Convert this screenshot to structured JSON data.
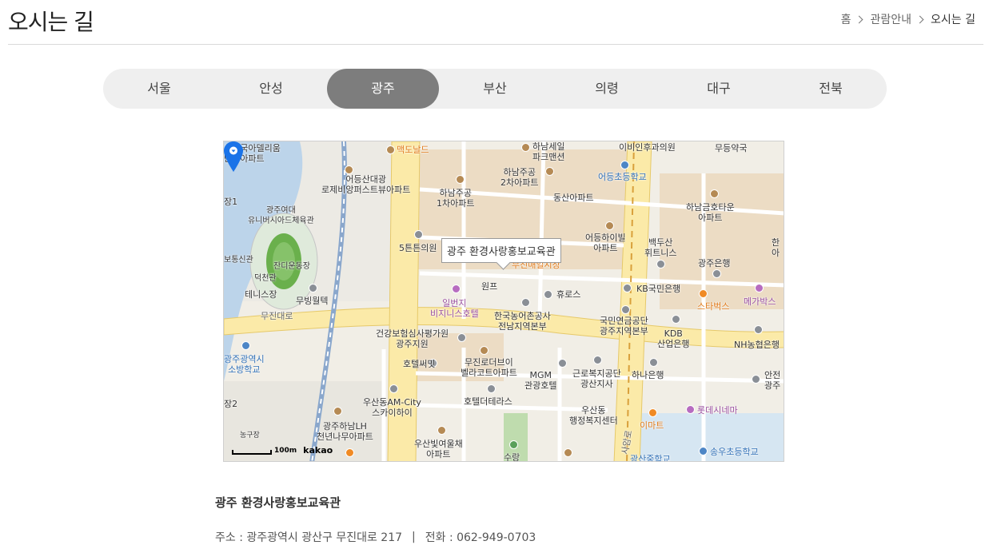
{
  "header": {
    "title": "오시는 길",
    "breadcrumb": [
      "홈",
      "관람안내",
      "오시는 길"
    ]
  },
  "tabs": [
    {
      "label": "서울",
      "active": false
    },
    {
      "label": "안성",
      "active": false
    },
    {
      "label": "광주",
      "active": true
    },
    {
      "label": "부산",
      "active": false
    },
    {
      "label": "의령",
      "active": false
    },
    {
      "label": "대구",
      "active": false
    },
    {
      "label": "전북",
      "active": false
    }
  ],
  "map": {
    "info_window": "광주 환경사랑홍보교육관",
    "scale_text": "100m",
    "provider_logo": "kakao",
    "labels": {
      "l01": "산한국아델리움\n단지아파트",
      "l02": "맥도날드",
      "l03": "하남세일\n파크맨션",
      "l04": "이비인후과의원",
      "l05": "무등약국",
      "l06": "어등산대광\n로제비앙퍼스트뷰아파트",
      "l07": "하남주공\n2차아파트",
      "l08": "어등초등학교",
      "l09": "하남주공\n1차아파트",
      "l10": "동산아파트",
      "l11": "장1",
      "l12": "광주여대\n유니버시아드체육관",
      "l13": "하남금호타운\n아파트",
      "l14": "어등하이빌\n아파트",
      "l15": "백두산\n휘트니스",
      "l16": "5튼튼의원",
      "l17": "광주은행",
      "l18": "한\n아",
      "l19": "보통신관",
      "l20": "잔디운동장",
      "l21": "덕천관",
      "l22": "무진매일시장",
      "l23": "원프",
      "l24": "휴로스",
      "l25": "KB국민은행",
      "l26": "테니스장",
      "l27": "무빙월텍",
      "l28": "일번지\n비지니스호텔",
      "l29": "스타벅스",
      "l30": "메가박스",
      "l31": "무진대로",
      "l32": "한국농어촌공사\n전남지역본부",
      "l33": "국민연금공단\n광주지역본부",
      "l34": "KDB\n산업은행",
      "l35": "건강보험심사평가원\n광주지원",
      "l36": "NH농협은행",
      "l37": "광주광역시\n소방학교",
      "l38": "호텔써밋",
      "l39": "무진로더브이\n벨라코트아파트",
      "l40": "MGM\n관광호텔",
      "l41": "근로복지공단\n광산지사",
      "l42": "하나은행",
      "l43": "안전\n광주",
      "l44": "장2",
      "l45": "우산동AM-City\n스카이하이",
      "l46": "호텔더테라스",
      "l47": "우산동\n행정복지센터",
      "l48": "롯데시네마",
      "l49": "광주하남LH\n천년나무아파트",
      "l50": "이마트",
      "l51": "농구장",
      "l52": "우산빛여울채\n아파트",
      "l53": "수랑",
      "l54": "사암로",
      "l55": "광산중학교",
      "l56": "송우초등학교"
    }
  },
  "place": {
    "name": "광주 환경사랑홍보교육관",
    "address_label": "주소 : 광주광역시 광산구 무진대로 217",
    "divider": "|",
    "phone_label": "전화 : 062-949-0703"
  },
  "colors": {
    "active_tab": "#7d7d7d",
    "tab_bar": "#efefef",
    "marker": "#1a73e8"
  }
}
